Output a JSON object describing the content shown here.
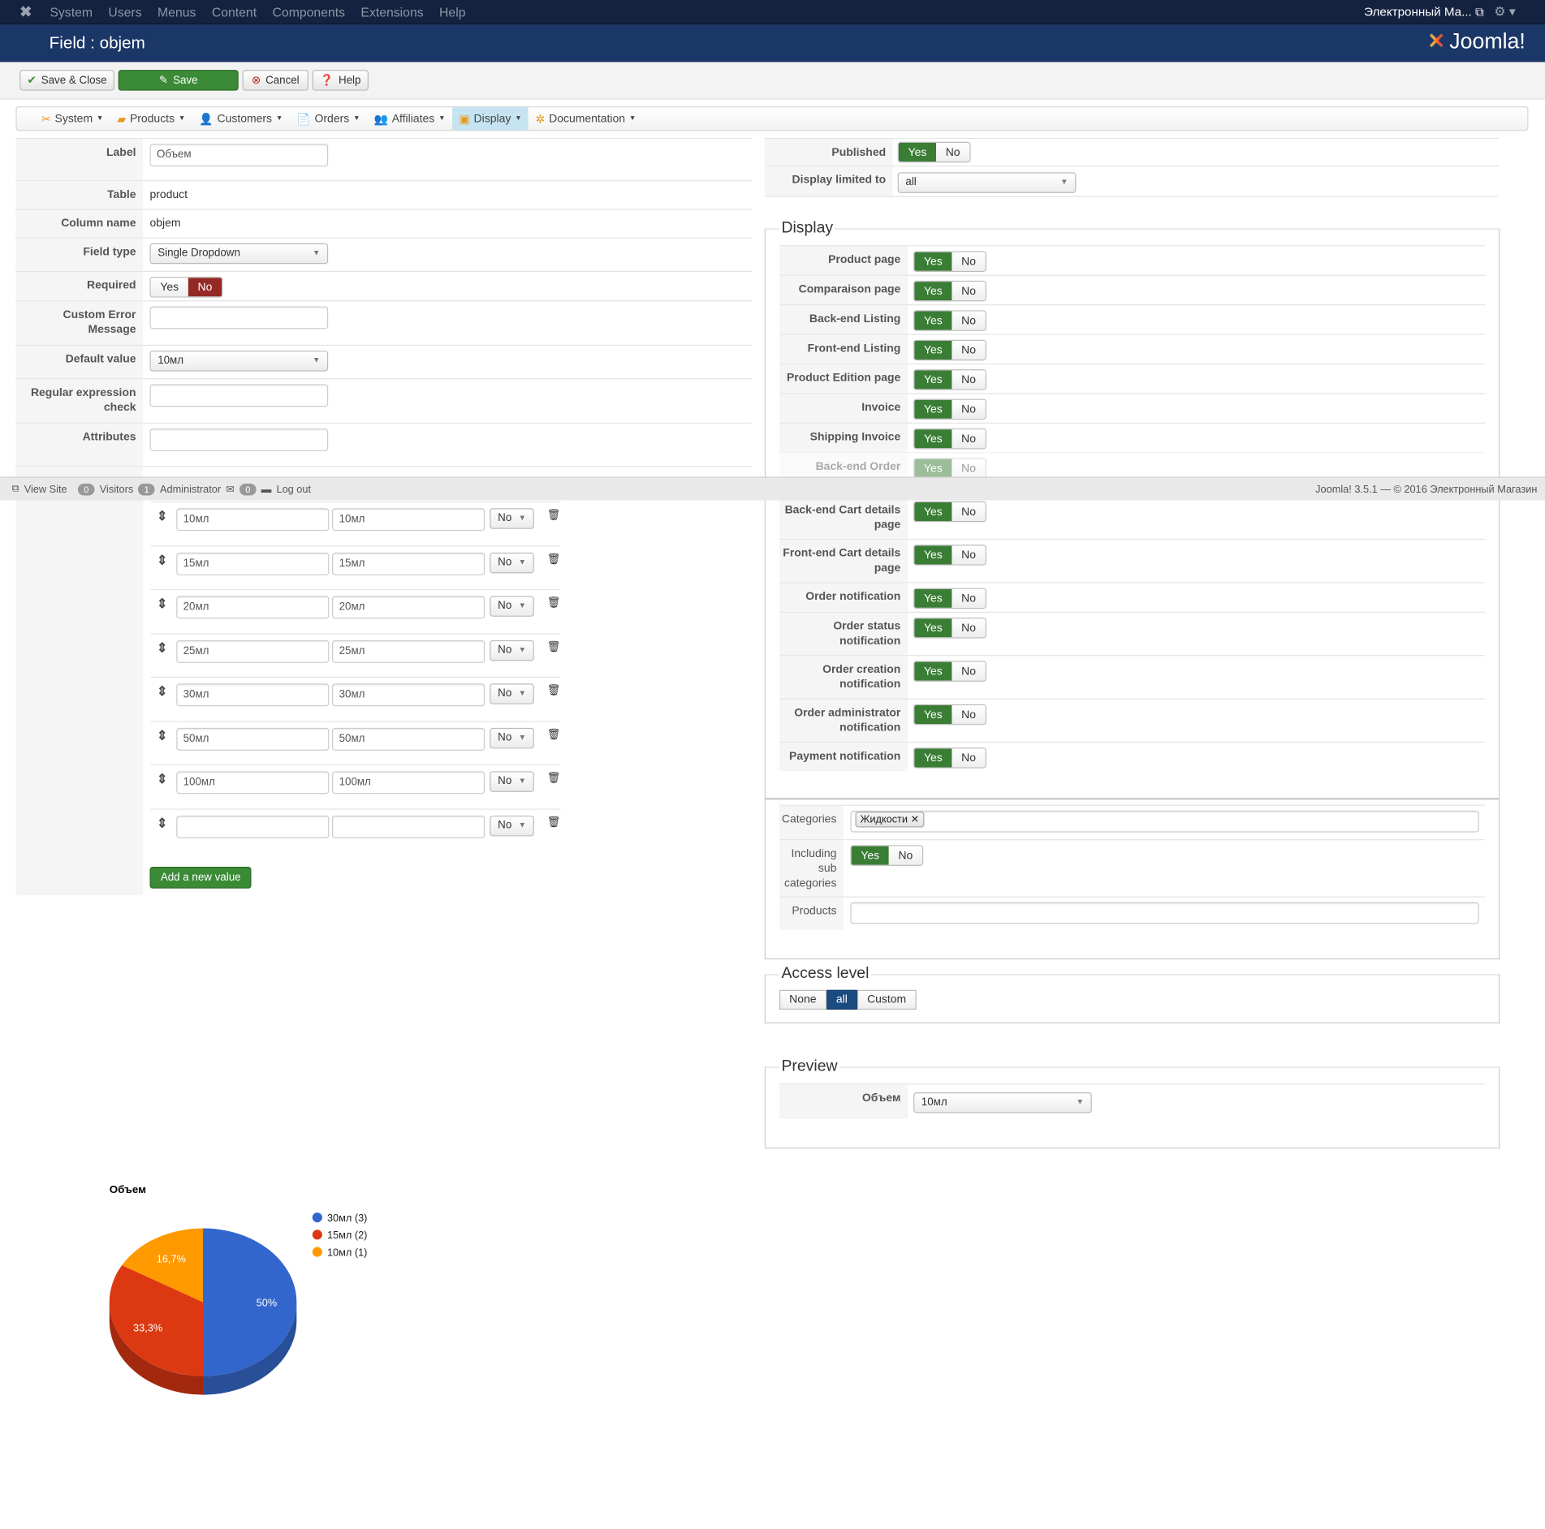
{
  "topnav": {
    "menu": [
      "System",
      "Users",
      "Menus",
      "Content",
      "Components",
      "Extensions",
      "Help"
    ],
    "site_name": "Электронный Ма..."
  },
  "header": {
    "title": "Field : objem",
    "brand": "Joomla!"
  },
  "toolbar": {
    "save_close": "Save & Close",
    "save": "Save",
    "cancel": "Cancel",
    "help": "Help"
  },
  "submenu": [
    {
      "label": "System",
      "icon": "tools-icon"
    },
    {
      "label": "Products",
      "icon": "box-icon"
    },
    {
      "label": "Customers",
      "icon": "users-icon"
    },
    {
      "label": "Orders",
      "icon": "orders-icon"
    },
    {
      "label": "Affiliates",
      "icon": "affiliates-icon"
    },
    {
      "label": "Display",
      "icon": "display-icon",
      "active": true
    },
    {
      "label": "Documentation",
      "icon": "lifebuoy-icon"
    }
  ],
  "field": {
    "label_label": "Label",
    "label_value": "Объем",
    "table_label": "Table",
    "table_value": "product",
    "column_label": "Column name",
    "column_value": "objem",
    "type_label": "Field type",
    "type_value": "Single Dropdown",
    "required_label": "Required",
    "yes": "Yes",
    "no": "No",
    "error_label": "Custom Error Message",
    "default_label": "Default value",
    "default_value": "10мл",
    "regex_label": "Regular expression check",
    "attributes_label": "Attributes"
  },
  "values": [
    {
      "value": "10мл",
      "title": "10мл",
      "disabled": "No"
    },
    {
      "value": "15мл",
      "title": "15мл",
      "disabled": "No"
    },
    {
      "value": "20мл",
      "title": "20мл",
      "disabled": "No"
    },
    {
      "value": "25мл",
      "title": "25мл",
      "disabled": "No"
    },
    {
      "value": "30мл",
      "title": "30мл",
      "disabled": "No"
    },
    {
      "value": "50мл",
      "title": "50мл",
      "disabled": "No"
    },
    {
      "value": "100мл",
      "title": "100мл",
      "disabled": "No"
    },
    {
      "value": "",
      "title": "",
      "disabled": "No"
    }
  ],
  "add_value": "Add a new value",
  "right": {
    "published_label": "Published",
    "limited_label": "Display limited to",
    "limited_value": "all"
  },
  "display": {
    "legend": "Display",
    "rows": [
      {
        "label": "Product page",
        "value": "Yes"
      },
      {
        "label": "Comparaison page",
        "value": "Yes"
      },
      {
        "label": "Back-end Listing",
        "value": "Yes"
      },
      {
        "label": "Front-end Listing",
        "value": "Yes"
      },
      {
        "label": "Product Edition page",
        "value": "Yes"
      },
      {
        "label": "Invoice",
        "value": "Yes"
      },
      {
        "label": "Shipping Invoice",
        "value": "Yes"
      },
      {
        "label": "Back-end Order",
        "value": "Yes"
      },
      {
        "label": "Back-end Cart details page",
        "value": "Yes"
      },
      {
        "label": "Front-end Cart details page",
        "value": "Yes"
      },
      {
        "label": "Order notification",
        "value": "Yes"
      },
      {
        "label": "Order status notification",
        "value": "Yes"
      },
      {
        "label": "Order creation notification",
        "value": "Yes"
      },
      {
        "label": "Order administrator notification",
        "value": "Yes"
      },
      {
        "label": "Payment notification",
        "value": "Yes"
      }
    ]
  },
  "restrict": {
    "categories_label": "Categories",
    "category_tag": "Жидкости",
    "sub_label": "Including sub categories",
    "products_label": "Products"
  },
  "access": {
    "legend": "Access level",
    "options": [
      "None",
      "all",
      "Custom"
    ],
    "selected": "all"
  },
  "preview": {
    "legend": "Preview",
    "label": "Объем",
    "value": "10мл"
  },
  "status": {
    "view_site": "View Site",
    "visitors_count": "0",
    "visitors": "Visitors",
    "admin_count": "1",
    "admin": "Administrator",
    "msg_count": "0",
    "logout": "Log out",
    "copyright": "Joomla! 3.5.1 — © 2016 Электронный Магазин"
  },
  "colors": {
    "green": "#3a7d35",
    "red": "#942a25",
    "navy": "#1b3767"
  },
  "chart_data": {
    "type": "pie",
    "title": "Объем",
    "categories": [
      "30мл (3)",
      "15мл (2)",
      "10мл (1)"
    ],
    "values": [
      3,
      2,
      1
    ],
    "labels": [
      "50%",
      "33,3%",
      "16,7%"
    ],
    "colors": [
      "#3366cc",
      "#dc3912",
      "#ff9900"
    ],
    "legend": "right"
  }
}
